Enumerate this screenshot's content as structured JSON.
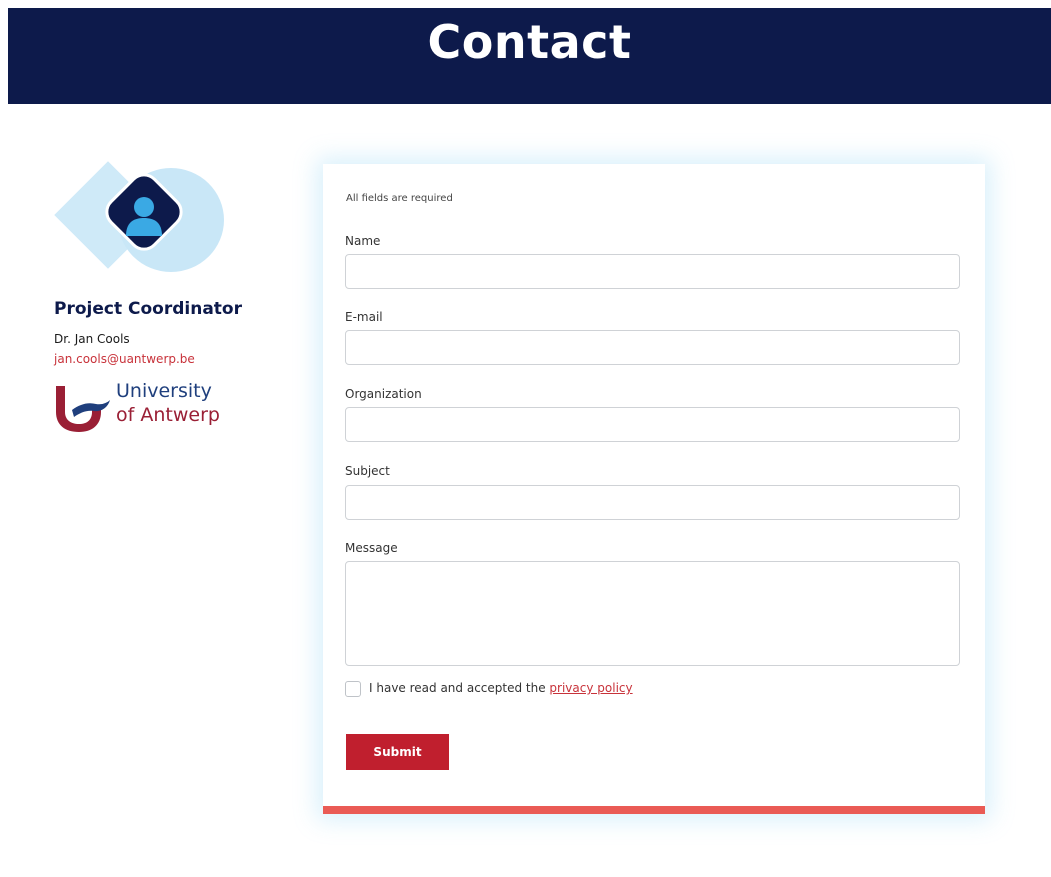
{
  "header": {
    "title": "Contact"
  },
  "contact": {
    "role": "Project Coordinator",
    "name": "Dr. Jan Cools",
    "email": "jan.cools@uantwerp.be",
    "logo": {
      "line1": "University",
      "line2": "of Antwerp"
    },
    "avatar_icon": "user-icon"
  },
  "form": {
    "required_note": "All fields are required",
    "fields": [
      {
        "label": "Name",
        "value": ""
      },
      {
        "label": "E-mail",
        "value": ""
      },
      {
        "label": "Organization",
        "value": ""
      },
      {
        "label": "Subject",
        "value": ""
      },
      {
        "label": "Message",
        "value": ""
      }
    ],
    "consent": {
      "text": "I have read and accepted the ",
      "link": "privacy policy",
      "checked": false
    },
    "submit_label": "Submit"
  },
  "colors": {
    "header_bg": "#0d1a4b",
    "accent_red": "#c01f2e",
    "link_red": "#c8323a",
    "card_bottom_bar": "#ea5b55",
    "avatar_light_blue": "#c9e7f7"
  }
}
